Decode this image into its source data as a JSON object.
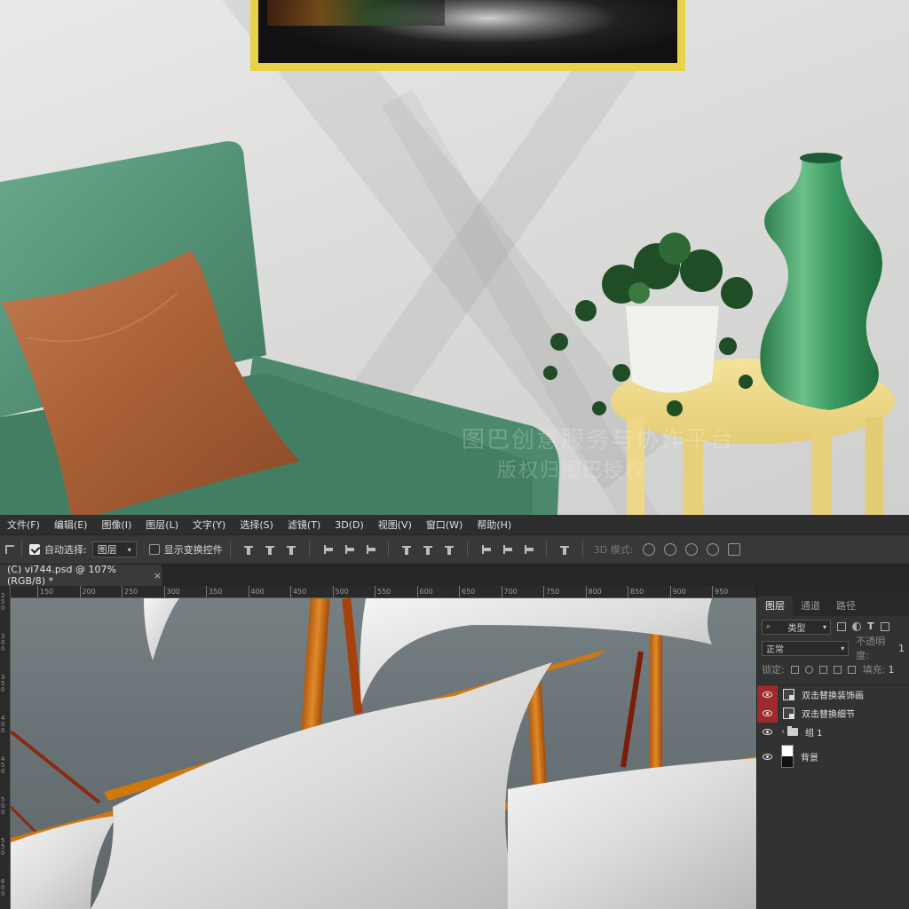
{
  "menu": [
    "文件(F)",
    "编辑(E)",
    "图像(I)",
    "图层(L)",
    "文字(Y)",
    "选择(S)",
    "滤镜(T)",
    "3D(D)",
    "视图(V)",
    "窗口(W)",
    "帮助(H)"
  ],
  "options": {
    "auto_select_label": "自动选择:",
    "auto_select_checked": true,
    "auto_select_target": "图层",
    "show_transform_label": "显示变换控件",
    "show_transform_checked": false,
    "mode_3d_label": "3D 模式:"
  },
  "document": {
    "tab_title": "(C) vi744.psd @ 107%(RGB/8) *",
    "close_glyph": "×"
  },
  "ruler": {
    "h_ticks": [
      "150",
      "200",
      "250",
      "300",
      "350",
      "400",
      "450",
      "500",
      "550",
      "600",
      "650",
      "700",
      "750",
      "800",
      "850",
      "900",
      "950"
    ],
    "v_ticks": [
      "250",
      "300",
      "350",
      "400",
      "450",
      "500",
      "550",
      "600"
    ]
  },
  "scene": {
    "watermark_line1": "图巴创意服务与协作平台",
    "watermark_line2": "版权归图巴授权"
  },
  "layers_panel": {
    "tabs": [
      "图层",
      "通道",
      "路径"
    ],
    "active_tab": "图层",
    "filter_kind": "类型",
    "blend_mode": "正常",
    "opacity_label": "不透明度:",
    "opacity_value": "1",
    "lock_label": "锁定:",
    "fill_label": "填充:",
    "fill_value": "1",
    "layers": [
      {
        "name": "双击替换装饰画",
        "type": "smart-object",
        "visible": true,
        "highlighted": true
      },
      {
        "name": "双击替换细节",
        "type": "smart-object",
        "visible": true,
        "highlighted": true
      },
      {
        "name": "组 1",
        "type": "group",
        "visible": true,
        "highlighted": false
      },
      {
        "name": "背景",
        "type": "background",
        "visible": true,
        "highlighted": false
      }
    ]
  },
  "colors": {
    "ui_dark": "#2b2b2b",
    "panel": "#323232",
    "visibility_highlight": "#a0292c",
    "frame_gold": "#e8d24a",
    "armchair_green": "#5a9a7c",
    "pillow_leather": "#b0643d",
    "table_yellow": "#f0dc8c",
    "vase_green": "#3a9a60"
  }
}
